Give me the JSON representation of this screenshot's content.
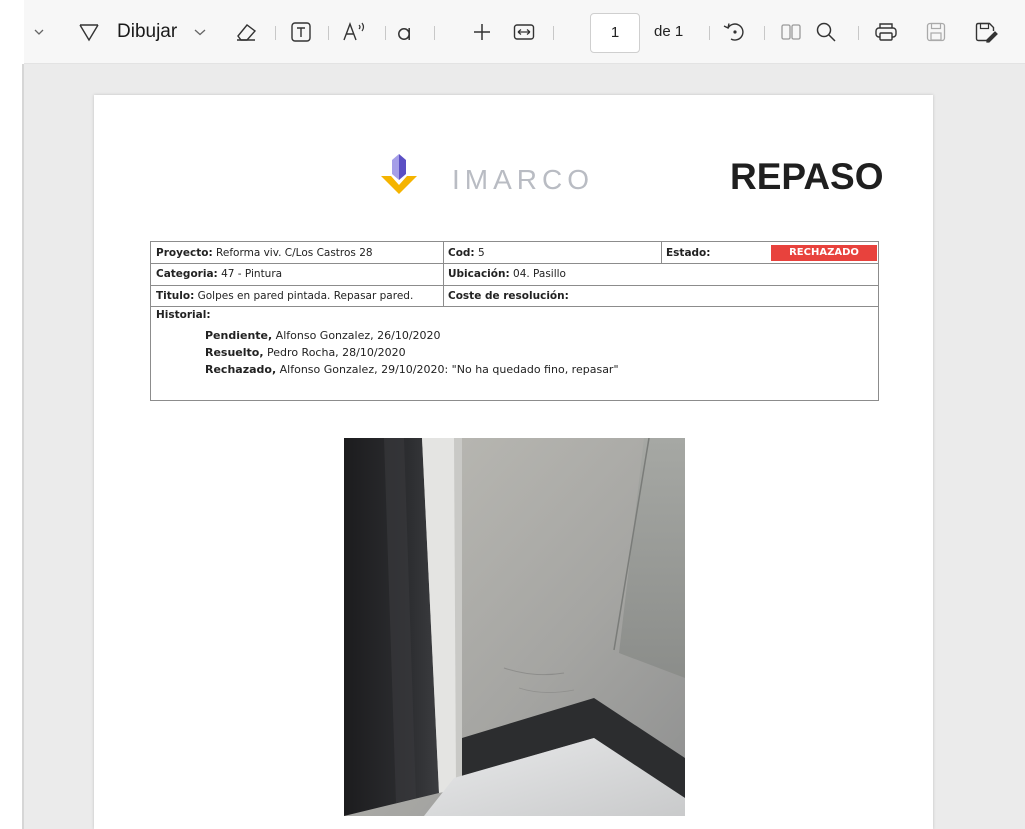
{
  "toolbar": {
    "draw_label": "Dibujar",
    "page_number": "1",
    "page_of": "de 1"
  },
  "document": {
    "brand": "IMARCO",
    "title": "REPASO",
    "info": {
      "proyecto_label": "Proyecto:",
      "proyecto_value": " Reforma viv. C/Los Castros 28",
      "cod_label": "Cod:",
      "cod_value": " 5",
      "estado_label": "Estado:",
      "estado_value": "RECHAZADO",
      "categoria_label": "Categoria:",
      "categoria_value": " 47 - Pintura",
      "ubicacion_label": "Ubicación:",
      "ubicacion_value": " 04. Pasillo",
      "titulo_label": "Titulo:",
      "titulo_value": " Golpes en pared pintada. Repasar pared.",
      "coste_label": "Coste de resolución:",
      "historial_label": "Historial:",
      "historial": [
        {
          "status": "Pendiente,",
          "detail": " Alfonso Gonzalez, 26/10/2020"
        },
        {
          "status": "Resuelto,",
          "detail": " Pedro Rocha, 28/10/2020"
        },
        {
          "status": "Rechazado,",
          "detail": " Alfonso Gonzalez, 29/10/2020: \"No ha quedado fino, repasar\""
        }
      ]
    }
  },
  "colors": {
    "status_rejected": "#e8423d",
    "logo_yellow": "#f5b400",
    "logo_purple": "#7b6fd6"
  },
  "icons": [
    "chevron-down-icon",
    "draw-icon",
    "eraser-icon",
    "text-box-icon",
    "read-aloud-icon",
    "text-style-icon",
    "zoom-in-icon",
    "fit-width-icon",
    "rotate-icon",
    "two-page-icon",
    "search-icon",
    "print-icon",
    "save-icon",
    "save-as-icon"
  ]
}
